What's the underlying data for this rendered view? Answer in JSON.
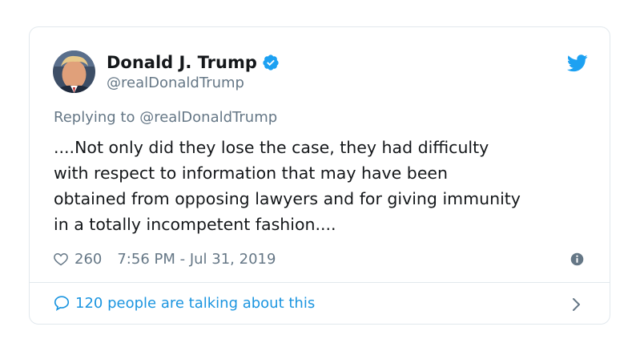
{
  "tweet": {
    "author_name": "Donald J. Trump",
    "author_handle": "@realDonaldTrump",
    "replying_to": "Replying to @realDonaldTrump",
    "lines": [
      "....Not only did they lose the case, they had difficulty",
      "with respect to information that may have been",
      "obtained from opposing lawyers and for giving immunity",
      "in a totally incompetent fashion...."
    ],
    "likes": "260",
    "timestamp": "7:56 PM - Jul 31, 2019",
    "talking_label": "120 people are talking about this"
  },
  "icons": {
    "verified": "verified-badge-icon",
    "twitter": "twitter-bird-icon",
    "like": "heart-icon",
    "info": "info-icon",
    "reply": "speech-bubble-icon",
    "chevron": "chevron-right-icon"
  },
  "colors": {
    "accent": "#1da1f2",
    "link": "#1b95e0",
    "secondary_text": "#657786",
    "primary_text": "#14171a",
    "border": "#e1e8ed"
  }
}
